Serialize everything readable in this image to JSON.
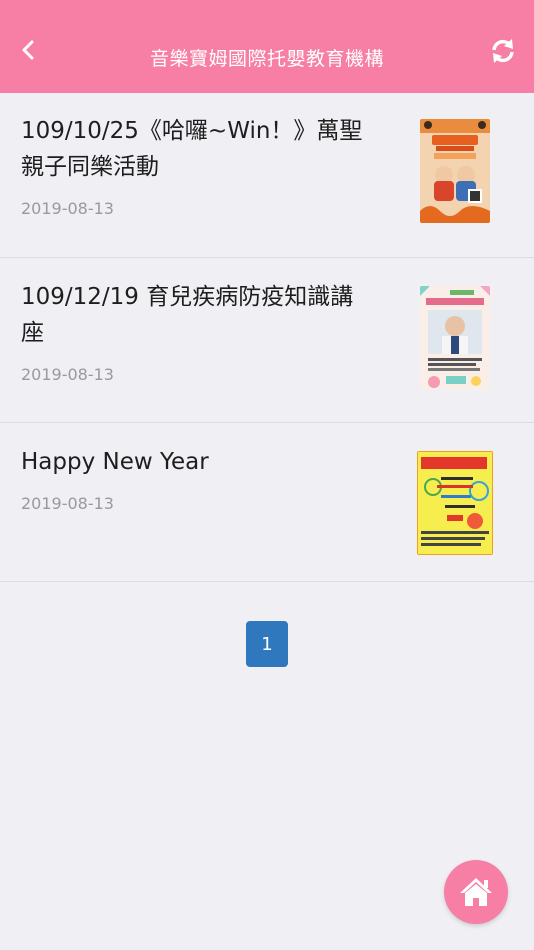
{
  "header": {
    "title": "音樂寶姆國際托嬰教育機構",
    "back_icon": "chevron-left-icon",
    "refresh_icon": "refresh-icon",
    "color": "#f77ea4"
  },
  "articles": [
    {
      "title": "109/10/25《哈囉~Win！》萬聖親子同樂活動",
      "date": "2019-08-13"
    },
    {
      "title": "109/12/19 育兒疾病防疫知識講座",
      "date": "2019-08-13"
    },
    {
      "title": "Happy New Year",
      "date": "2019-08-13"
    }
  ],
  "pagination": {
    "current": "1",
    "color": "#2f78be"
  },
  "fab": {
    "icon": "home-icon"
  }
}
